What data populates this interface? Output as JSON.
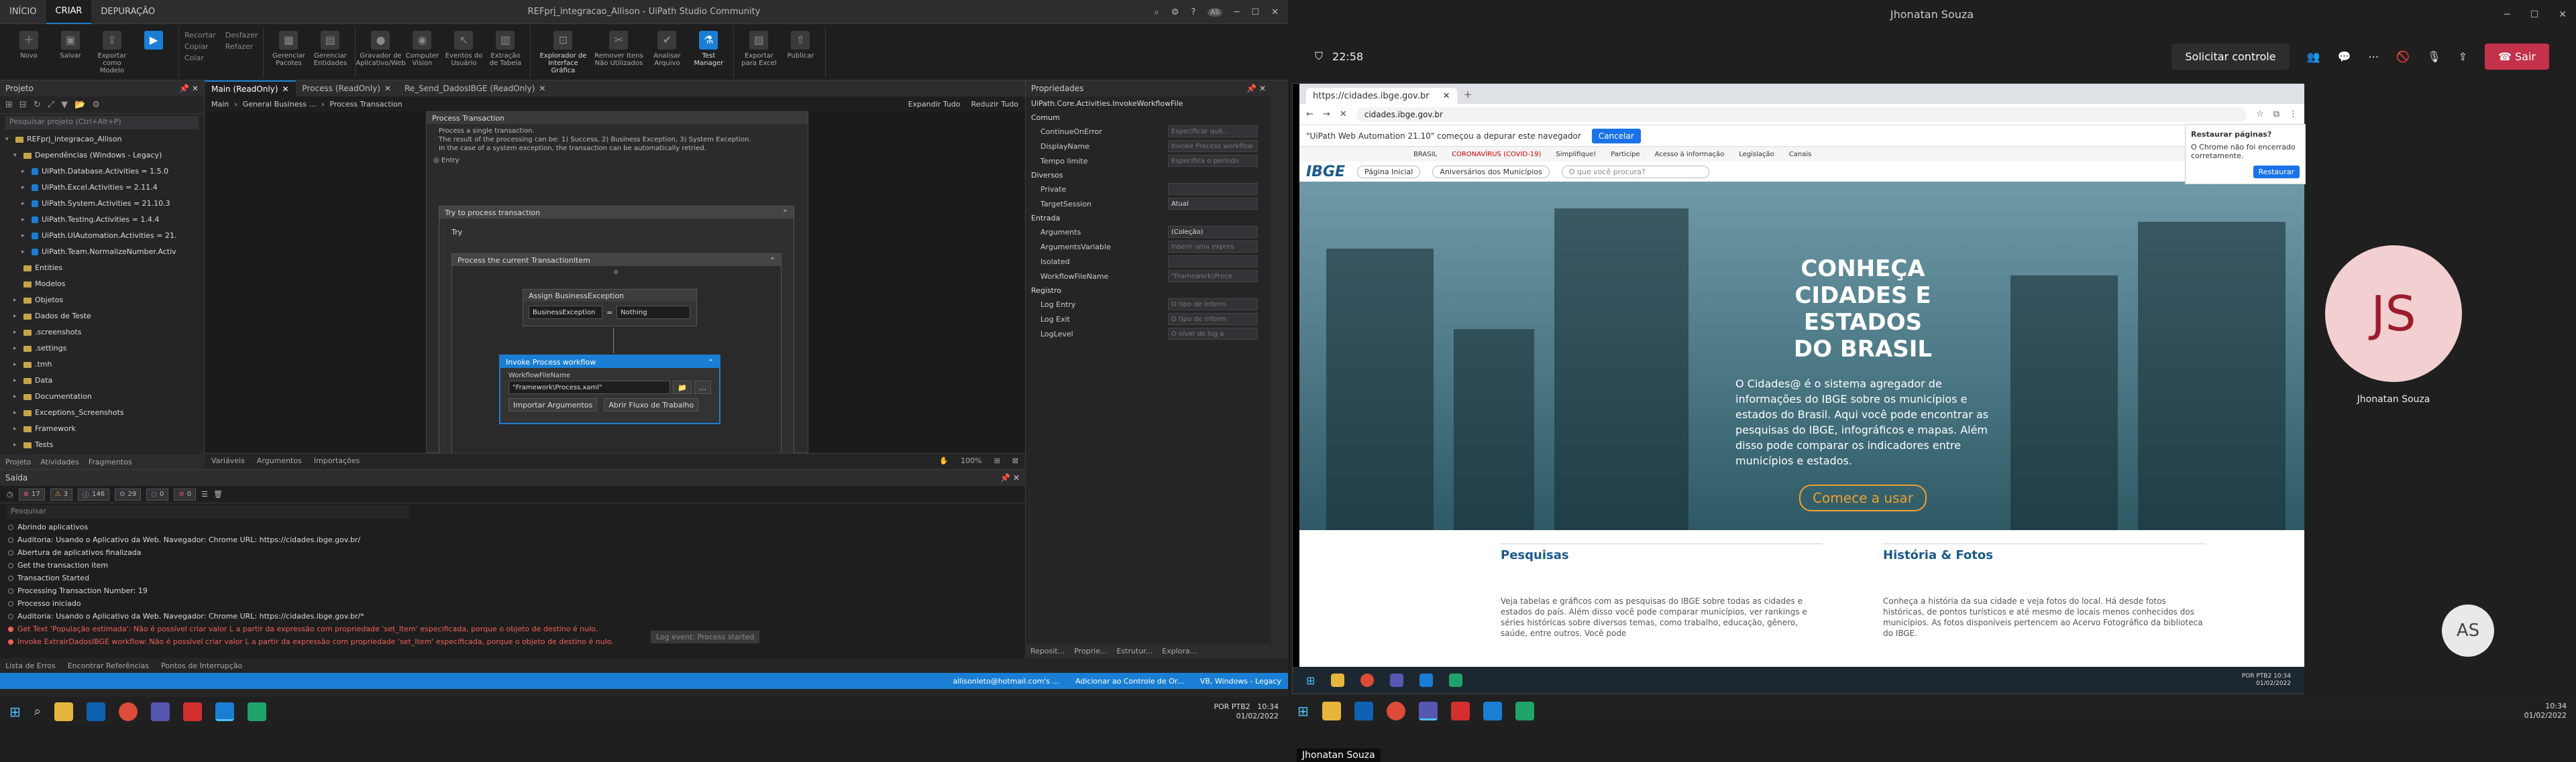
{
  "studio": {
    "ribbon_tabs": [
      "INÍCIO",
      "CRIAR",
      "DEPURAÇÃO"
    ],
    "active_ribbon_tab": "CRIAR",
    "title": "REFprj_integracao_Allison - UiPath Studio Community",
    "ribbon": {
      "novo": "Novo",
      "salvar": "Salvar",
      "exportar": "Exportar como Modelo",
      "recortar": "Recortar",
      "copiar": "Copiar",
      "colar": "Colar",
      "desfazer": "Desfazer",
      "refazer": "Refazer",
      "gerenciar_pacotes": "Gerenciar Pacotes",
      "gerenciar_entidades": "Gerenciar Entidades",
      "gravador": "Gravador de Aplicativo/Web",
      "computer_vision": "Computer Vision",
      "eventos": "Eventos do Usuário",
      "extracao": "Extração de Tabela",
      "explorador": "Explorador de Interface Gráfica",
      "remover": "Remover Itens Não Utilizados",
      "analisar": "Analisar Arquivo",
      "test_manager": "Test Manager",
      "exportar_excel": "Exportar para Excel",
      "publicar": "Publicar"
    },
    "project": {
      "header": "Projeto",
      "search_placeholder": "Pesquisar projeto (Ctrl+Alt+P)",
      "tree": [
        {
          "label": "REFprj_integracao_Allison",
          "indent": 0,
          "kind": "folder",
          "arrow": "▾"
        },
        {
          "label": "Dependências (Windows - Legacy)",
          "indent": 1,
          "kind": "folder",
          "arrow": "▾"
        },
        {
          "label": "UiPath.Database.Activities = 1.5.0",
          "indent": 2,
          "kind": "pkg",
          "arrow": "▸"
        },
        {
          "label": "UiPath.Excel.Activities = 2.11.4",
          "indent": 2,
          "kind": "pkg",
          "arrow": "▸"
        },
        {
          "label": "UiPath.System.Activities = 21.10.3",
          "indent": 2,
          "kind": "pkg",
          "arrow": "▸"
        },
        {
          "label": "UiPath.Testing.Activities = 1.4.4",
          "indent": 2,
          "kind": "pkg",
          "arrow": "▸"
        },
        {
          "label": "UiPath.UIAutomation.Activities = 21.",
          "indent": 2,
          "kind": "pkg",
          "arrow": "▸"
        },
        {
          "label": "UiPath.Team.NormalizeNumber.Activ",
          "indent": 2,
          "kind": "pkg",
          "arrow": "▸"
        },
        {
          "label": "Entities",
          "indent": 1,
          "kind": "folder",
          "arrow": ""
        },
        {
          "label": "Modelos",
          "indent": 1,
          "kind": "folder",
          "arrow": ""
        },
        {
          "label": "Objetos",
          "indent": 1,
          "kind": "folder",
          "arrow": "▸"
        },
        {
          "label": "Dados de Teste",
          "indent": 1,
          "kind": "folder",
          "arrow": "▸"
        },
        {
          "label": ".screenshots",
          "indent": 1,
          "kind": "folder",
          "arrow": "▸"
        },
        {
          "label": ".settings",
          "indent": 1,
          "kind": "folder",
          "arrow": "▸"
        },
        {
          "label": ".tmh",
          "indent": 1,
          "kind": "folder",
          "arrow": "▸"
        },
        {
          "label": "Data",
          "indent": 1,
          "kind": "folder",
          "arrow": "▸"
        },
        {
          "label": "Documentation",
          "indent": 1,
          "kind": "folder",
          "arrow": "▸"
        },
        {
          "label": "Exceptions_Screenshots",
          "indent": 1,
          "kind": "folder",
          "arrow": "▸"
        },
        {
          "label": "Framework",
          "indent": 1,
          "kind": "folder",
          "arrow": "▸"
        },
        {
          "label": "Tests",
          "indent": 1,
          "kind": "folder",
          "arrow": "▸"
        }
      ],
      "bottom_tabs": [
        "Projeto",
        "Atividades",
        "Fragmentos"
      ]
    },
    "doc_tabs": [
      {
        "label": "Main (ReadOnly)",
        "active": true
      },
      {
        "label": "Process (ReadOnly)",
        "active": false
      },
      {
        "label": "Re_Send_DadosIBGE (ReadOnly)",
        "active": false
      }
    ],
    "breadcrumb": [
      "Main",
      "General Business ...",
      "Process Transaction"
    ],
    "expand_all": "Expandir Tudo",
    "collapse_all": "Reduzir Tudo",
    "designer": {
      "seq_title": "Process Transaction",
      "annotation": [
        "Process a single transaction.",
        "The result of the processing can be: 1) Success, 2) Business Exception, 3) System Exception.",
        "In the case of a system exception, the transaction can be automatically retried."
      ],
      "entry": "Entry",
      "try_catch": "Try to process transaction",
      "try": "Try",
      "inner": "Process the current TransactionItem",
      "assign_title": "Assign BusinessException",
      "assign_to": "BusinessException",
      "assign_eq": "=",
      "assign_value": "Nothing",
      "invoke_title": "Invoke Process workflow",
      "workflow_label": "WorkflowFileName",
      "workflow_value": "\"Framework\\Process.xaml\"",
      "import_args": "Importar Argumentos",
      "open_workflow": "Abrir Fluxo de Trabalho"
    },
    "designer_foot": [
      "Variáveis",
      "Argumentos",
      "Importações"
    ],
    "zoom": "100%",
    "properties": {
      "header": "Propriedades",
      "activity": "UiPath.Core.Activities.InvokeWorkflowFile",
      "groups": [
        {
          "name": "Comum",
          "rows": [
            {
              "n": "ContinueOnError",
              "v": "Especificar quê...",
              "val": false
            },
            {
              "n": "DisplayName",
              "v": "Invoke Process workflow",
              "val": false
            },
            {
              "n": "Tempo limite",
              "v": "Especifica o período",
              "val": false
            }
          ]
        },
        {
          "name": "Diversos",
          "rows": [
            {
              "n": "Private",
              "v": "",
              "val": false
            },
            {
              "n": "TargetSession",
              "v": "Atual",
              "val": true
            }
          ]
        },
        {
          "name": "Entrada",
          "rows": [
            {
              "n": "Arguments",
              "v": "(Coleção)",
              "val": true
            },
            {
              "n": "ArgumentsVariable",
              "v": "Inserir uma expres",
              "val": false
            },
            {
              "n": "Isolated",
              "v": "",
              "val": false
            },
            {
              "n": "WorkflowFileName",
              "v": "\"Framework\\Proce",
              "val": false
            }
          ]
        },
        {
          "name": "Registro",
          "rows": [
            {
              "n": "Log Entry",
              "v": "O tipo de inform",
              "val": false
            },
            {
              "n": "Log Exit",
              "v": "O tipo de inform",
              "val": false
            },
            {
              "n": "LogLevel",
              "v": "O nível de log a",
              "val": false
            }
          ]
        }
      ],
      "foot": [
        "Reposit...",
        "Proprie...",
        "Estrutur...",
        "Explora..."
      ]
    },
    "output": {
      "header": "Saída",
      "badges": [
        "17",
        "3",
        "146",
        "29",
        "0",
        "0"
      ],
      "search_placeholder": "Pesquisar",
      "lines": [
        {
          "t": "Abrindo aplicativos",
          "err": false
        },
        {
          "t": "Auditoria: Usando o Aplicativo da Web. Navegador: Chrome URL: https://cidades.ibge.gov.br/",
          "err": false
        },
        {
          "t": "Abertura de aplicativos finalizada",
          "err": false
        },
        {
          "t": "Get the transaction item",
          "err": false
        },
        {
          "t": "Transaction Started",
          "err": false
        },
        {
          "t": "Processing Transaction Number: 19",
          "err": false
        },
        {
          "t": "Processo iniciado",
          "err": false
        },
        {
          "t": "Auditoria: Usando o Aplicativo da Web. Navegador: Chrome URL: https://cidades.ibge.gov.br/*",
          "err": false
        },
        {
          "t": "Get Text 'População estimada': Não é possível criar valor L a partir da expressão com propriedade 'set_Item' especificada, porque o objeto de destino é nulo.",
          "err": true
        },
        {
          "t": "Invoke ExtrairDadosIBGE workflow: Não é possível criar valor L a partir da expressão com propriedade 'set_Item' especificada, porque o objeto de destino é nulo.",
          "err": true
        }
      ],
      "overlay": "Log event: Process started"
    },
    "bottom_tabs": [
      "Lista de Erros",
      "Encontrar Referências",
      "Pontos de Interrupção"
    ],
    "status": {
      "user": "allisonleto@hotmail.com's ...",
      "source_control": "Adicionar ao Controle de Or...",
      "mode": "VB, Windows - Legacy"
    },
    "clock": {
      "lang": "POR PTB2",
      "time": "10:34",
      "date": "01/02/2022"
    }
  },
  "teams": {
    "title": "Jhonatan Souza",
    "timer": "22:58",
    "request_control": "Solicitar controle",
    "leave": "Sair",
    "presenter": "Jhonatan Souza",
    "remote": {
      "tab_title": "https://cidades.ibge.gov.br",
      "url": "cidades.ibge.gov.br",
      "infobar": "\"UiPath Web Automation 21.10\" começou a depurar este navegador",
      "cancel": "Cancelar",
      "gov_links": [
        "BRASIL",
        "CORONAVÍRUS (COVID-19)",
        "Simplifique!",
        "Participe",
        "Acesso à informação",
        "Legislação",
        "Canais"
      ],
      "logo": "IBGE",
      "nav_pills": [
        "Página Inicial",
        "Aniversários dos Municípios"
      ],
      "search_placeholder": "O que você procura?",
      "hero_title": [
        "CONHEÇA",
        "CIDADES E ESTADOS",
        "DO BRASIL"
      ],
      "hero_desc": "O Cidades@ é o sistema agregador de informações do IBGE sobre os municípios e estados do Brasil. Aqui você pode encontrar as pesquisas do IBGE, infográficos e mapas. Além disso pode comparar os indicadores entre municípios e estados.",
      "hero_button": "Comece a usar",
      "col1_title": "Pesquisas",
      "col1_text": "Veja tabelas e gráficos com as pesquisas do IBGE sobre todas as cidades e estados do país. Além disso você pode comparar municípios, ver rankings e séries históricas sobre diversos temas, como trabalho, educação, gênero, saúde, entre outros. Você pode",
      "col2_title": "História & Fotos",
      "col2_text": "Conheça a história da sua cidade e veja fotos do local. Há desde fotos históricas, de pontos turísticos e até mesmo de locais menos conhecidos dos municípios. As fotos disponíveis pertencem ao Acervo Fotográfico da biblioteca do IBGE.",
      "restore_title": "Restaurar páginas?",
      "restore_text": "O Chrome não foi encerrado corretamente.",
      "restore_btn": "Restaurar",
      "clock": {
        "lang": "POR PTB2",
        "time": "10:34",
        "date": "01/02/2022"
      }
    },
    "participants": [
      {
        "initials": "JS",
        "name": "Jhonatan Souza"
      },
      {
        "initials": "AS"
      }
    ],
    "clock": {
      "time": "10:34",
      "date": "01/02/2022"
    }
  }
}
